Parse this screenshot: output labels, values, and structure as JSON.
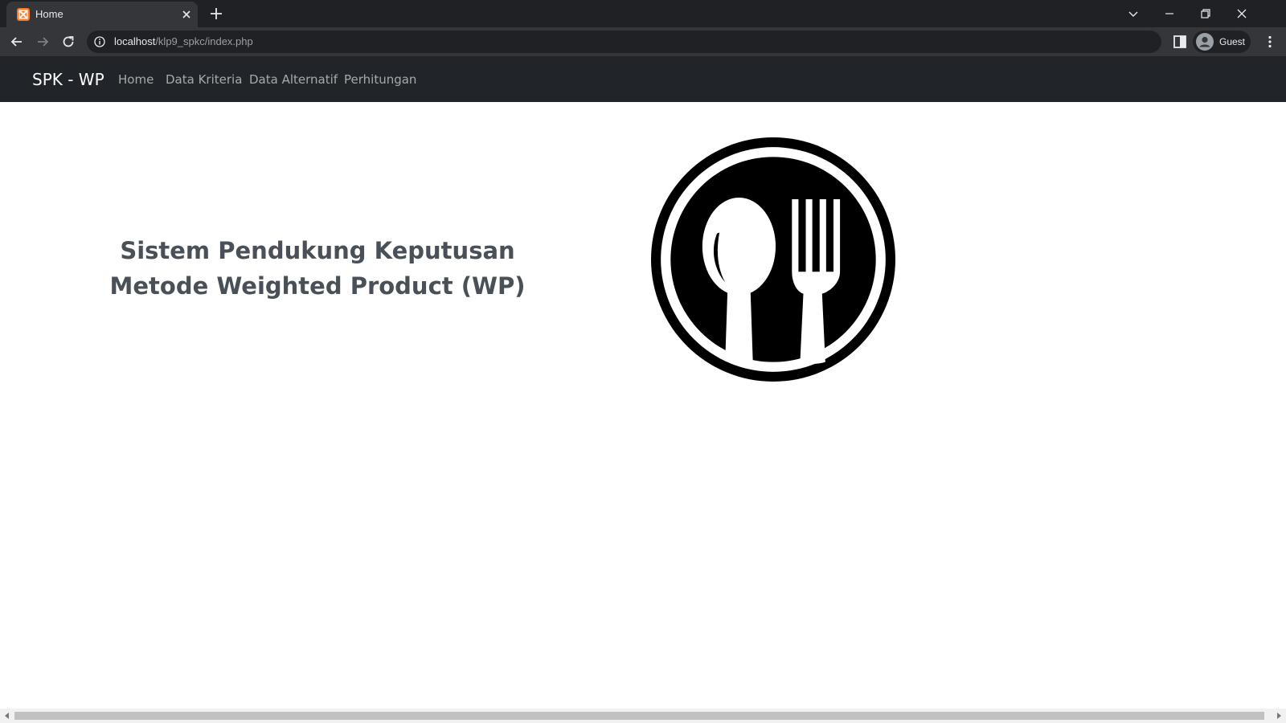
{
  "browser": {
    "tab_title": "Home",
    "url_host": "localhost",
    "url_path": "/klp9_spkc/index.php",
    "profile_label": "Guest",
    "colors": {
      "frame": "#202124",
      "toolbar": "#35363a",
      "favicon": "#fb7a24"
    }
  },
  "navbar": {
    "brand": "SPK - WP",
    "links": [
      "Home",
      "Data Kriteria",
      "Data Alternatif",
      "Perhitungan"
    ],
    "background": "#212529"
  },
  "hero": {
    "line1": "Sistem Pendukung Keputusan",
    "line2": "Metode Weighted Product (WP)",
    "logo_icon": "plate-spoon-fork-icon"
  },
  "icons": [
    "xampp-favicon",
    "close-icon",
    "plus-icon",
    "chevron-down-icon",
    "minimize-icon",
    "restore-icon",
    "back-arrow-icon",
    "forward-arrow-icon",
    "reload-icon",
    "info-icon",
    "side-panel-icon",
    "account-icon",
    "kebab-menu-icon"
  ]
}
